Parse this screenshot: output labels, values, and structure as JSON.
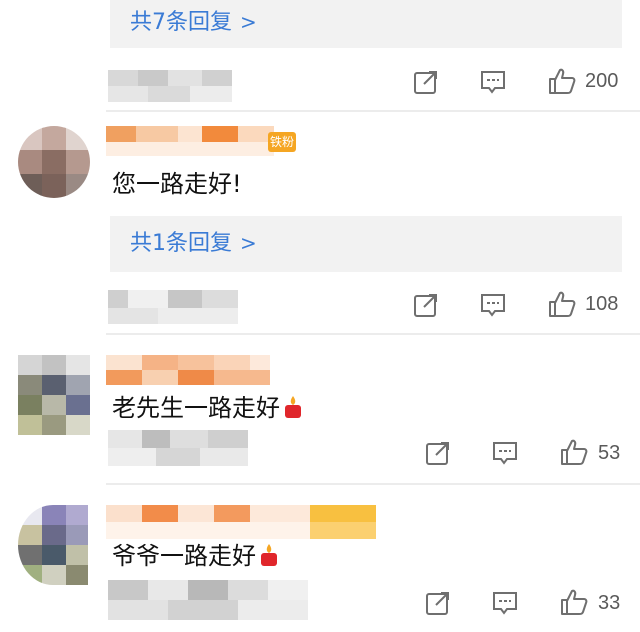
{
  "threads": [
    {
      "reply_link": "共7条回复",
      "likes": "200"
    },
    {
      "comment": "您一路走好!",
      "reply_link": "共1条回复",
      "likes": "108",
      "badge": "铁粉"
    },
    {
      "comment": "老先生一路走好",
      "likes": "53"
    },
    {
      "comment": "爷爷一路走好",
      "likes": "33"
    }
  ],
  "icons": {
    "share": "share-icon",
    "comment": "comment-icon",
    "like": "thumbs-up-icon",
    "candle": "candle-emoji"
  },
  "colors": {
    "link": "#3a7bd5",
    "reply_bg": "#f2f2f2",
    "icon": "#6f6f6f",
    "badge": "#f5a623"
  }
}
